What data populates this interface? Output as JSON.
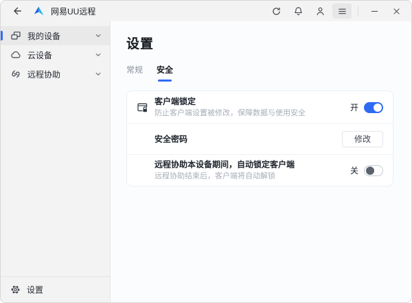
{
  "titlebar": {
    "title": "网易UU远程"
  },
  "sidebar": {
    "items": [
      {
        "label": "我的设备",
        "icon": "devices-icon",
        "selected": true
      },
      {
        "label": "云设备",
        "icon": "cloud-icon",
        "selected": false
      },
      {
        "label": "远程协助",
        "icon": "remote-assist-icon",
        "selected": false
      }
    ],
    "footer": {
      "label": "设置",
      "icon": "gear-icon"
    }
  },
  "main": {
    "title": "设置",
    "tabs": [
      {
        "label": "常规",
        "active": false
      },
      {
        "label": "安全",
        "active": true
      }
    ],
    "settings": [
      {
        "title": "客户端锁定",
        "description": "防止客户端设置被修改，保障数据与使用安全",
        "control": "toggle",
        "state": "on",
        "state_label": "开",
        "icon": "client-lock-icon"
      },
      {
        "title": "安全密码",
        "control": "button",
        "button_label": "修改"
      },
      {
        "title": "远程协助本设备期间，自动锁定客户端",
        "description": "远程协助结束后，客户端将自动解锁",
        "control": "toggle",
        "state": "off",
        "state_label": "关"
      }
    ]
  },
  "colors": {
    "accent": "#2e6bf2",
    "titlebar_bg": "#f3f3f3",
    "sidebar_bg": "#f3f3f3",
    "sidebar_selected_bg": "#e9e9e9",
    "main_bg": "#fafcfe",
    "card_bg": "#ffffff",
    "toggle_off_knob": "#5a626e"
  }
}
